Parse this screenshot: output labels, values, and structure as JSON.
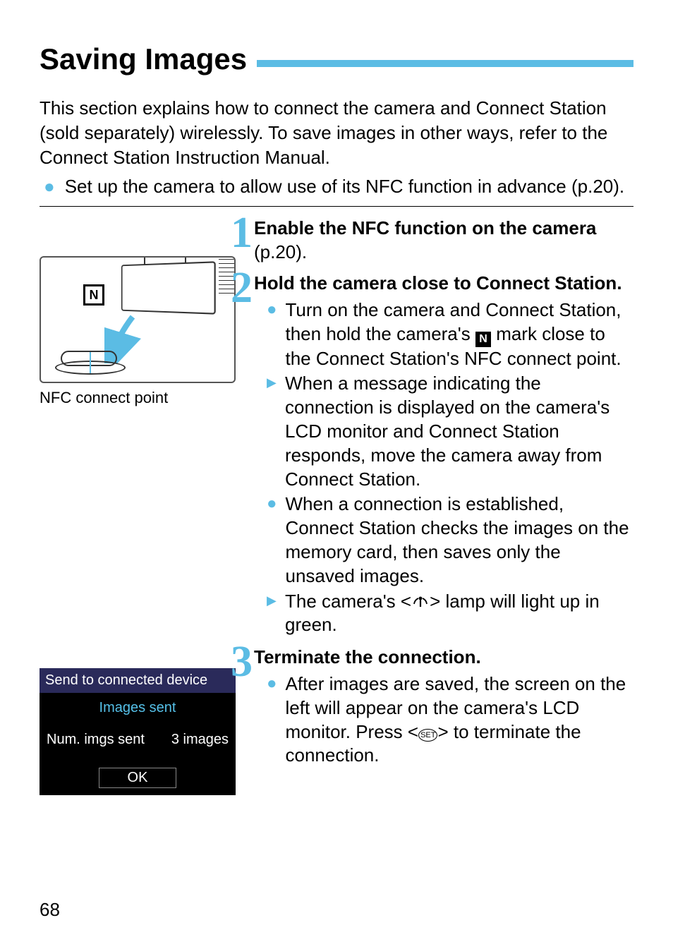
{
  "title": "Saving Images",
  "intro": "This section explains how to connect the camera and Connect Station (sold separately) wirelessly. To save images in other ways, refer to the Connect Station Instruction Manual.",
  "advance_note": "Set up the camera to allow use of its NFC function in advance (p.20).",
  "figure_caption": "NFC connect point",
  "nfc_mark_glyph": "N",
  "steps": {
    "s1": {
      "num": "1",
      "title_strong": "Enable the NFC function on the camera",
      "title_tail": " (p.20)."
    },
    "s2": {
      "num": "2",
      "title": "Hold the camera close to Connect Station.",
      "b1a": "Turn on the camera and Connect Station, then hold the camera's ",
      "b1b": " mark close to the Connect Station's NFC connect point.",
      "b2": "When a message indicating the connection is displayed on the camera's LCD monitor and Connect Station responds, move the camera away from Connect Station.",
      "b3": "When a connection is established, Connect Station checks the images on the memory card, then saves only the unsaved images.",
      "b4a": "The camera's <",
      "b4b": "> lamp will light up in green."
    },
    "s3": {
      "num": "3",
      "title": "Terminate the connection.",
      "b1a": "After images are saved, the screen on the left will appear on the camera's LCD monitor. Press <",
      "b1b": "> to terminate the connection."
    }
  },
  "lcd": {
    "title": "Send to connected device",
    "subtitle": "Images sent",
    "row_label": "Num. imgs sent",
    "row_value": "3 images",
    "ok": "OK"
  },
  "icons": {
    "set": "SET"
  },
  "page_number": "68"
}
